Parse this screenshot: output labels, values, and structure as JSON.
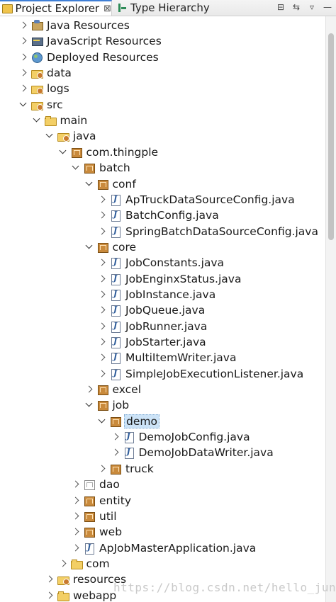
{
  "tabs": [
    {
      "label": "Project Explorer",
      "icon": "project-explorer-icon",
      "close": "⊠"
    },
    {
      "label": "Type Hierarchy",
      "icon": "type-hierarchy-icon"
    }
  ],
  "toolbar": {
    "icons": [
      "collapse-all-icon",
      "link-with-editor-icon",
      "view-menu-icon",
      "minimize-icon"
    ]
  },
  "tree": [
    {
      "label": "Java Resources",
      "depth": 1,
      "twisty": "closed",
      "icon": "java-resources-icon"
    },
    {
      "label": "JavaScript Resources",
      "depth": 1,
      "twisty": "closed",
      "icon": "javascript-resources-icon"
    },
    {
      "label": "Deployed Resources",
      "depth": 1,
      "twisty": "closed",
      "icon": "deployed-resources-icon"
    },
    {
      "label": "data",
      "depth": 1,
      "twisty": "closed",
      "icon": "source-folder-icon"
    },
    {
      "label": "logs",
      "depth": 1,
      "twisty": "closed",
      "icon": "source-folder-icon"
    },
    {
      "label": "src",
      "depth": 1,
      "twisty": "open",
      "icon": "source-folder-icon"
    },
    {
      "label": "main",
      "depth": 2,
      "twisty": "open",
      "icon": "folder-icon"
    },
    {
      "label": "java",
      "depth": 3,
      "twisty": "open",
      "icon": "source-folder-icon"
    },
    {
      "label": "com.thingple",
      "depth": 4,
      "twisty": "open",
      "icon": "package-icon"
    },
    {
      "label": "batch",
      "depth": 5,
      "twisty": "open",
      "icon": "package-icon"
    },
    {
      "label": "conf",
      "depth": 6,
      "twisty": "open",
      "icon": "package-icon"
    },
    {
      "label": "ApTruckDataSourceConfig.java",
      "depth": 7,
      "twisty": "closed",
      "icon": "java-file-icon"
    },
    {
      "label": "BatchConfig.java",
      "depth": 7,
      "twisty": "closed",
      "icon": "java-file-icon"
    },
    {
      "label": "SpringBatchDataSourceConfig.java",
      "depth": 7,
      "twisty": "closed",
      "icon": "java-file-icon"
    },
    {
      "label": "core",
      "depth": 6,
      "twisty": "open",
      "icon": "package-icon"
    },
    {
      "label": "JobConstants.java",
      "depth": 7,
      "twisty": "closed",
      "icon": "java-file-icon"
    },
    {
      "label": "JobEnginxStatus.java",
      "depth": 7,
      "twisty": "closed",
      "icon": "java-file-icon"
    },
    {
      "label": "JobInstance.java",
      "depth": 7,
      "twisty": "closed",
      "icon": "java-file-icon"
    },
    {
      "label": "JobQueue.java",
      "depth": 7,
      "twisty": "closed",
      "icon": "java-file-icon"
    },
    {
      "label": "JobRunner.java",
      "depth": 7,
      "twisty": "closed",
      "icon": "java-file-icon"
    },
    {
      "label": "JobStarter.java",
      "depth": 7,
      "twisty": "closed",
      "icon": "java-file-icon"
    },
    {
      "label": "MultiItemWriter.java",
      "depth": 7,
      "twisty": "closed",
      "icon": "java-file-icon"
    },
    {
      "label": "SimpleJobExecutionListener.java",
      "depth": 7,
      "twisty": "closed",
      "icon": "java-file-icon"
    },
    {
      "label": "excel",
      "depth": 6,
      "twisty": "closed",
      "icon": "package-icon"
    },
    {
      "label": "job",
      "depth": 6,
      "twisty": "open",
      "icon": "package-icon"
    },
    {
      "label": "demo",
      "depth": 7,
      "twisty": "open",
      "icon": "package-icon",
      "selected": true
    },
    {
      "label": "DemoJobConfig.java",
      "depth": 8,
      "twisty": "closed",
      "icon": "java-file-icon"
    },
    {
      "label": "DemoJobDataWriter.java",
      "depth": 8,
      "twisty": "closed",
      "icon": "java-file-icon"
    },
    {
      "label": "truck",
      "depth": 7,
      "twisty": "closed",
      "icon": "package-icon"
    },
    {
      "label": "dao",
      "depth": 5,
      "twisty": "closed",
      "icon": "empty-package-icon"
    },
    {
      "label": "entity",
      "depth": 5,
      "twisty": "closed",
      "icon": "package-icon"
    },
    {
      "label": "util",
      "depth": 5,
      "twisty": "closed",
      "icon": "package-icon"
    },
    {
      "label": "web",
      "depth": 5,
      "twisty": "closed",
      "icon": "package-icon"
    },
    {
      "label": "ApJobMasterApplication.java",
      "depth": 5,
      "twisty": "closed",
      "icon": "java-file-icon"
    },
    {
      "label": "com",
      "depth": 4,
      "twisty": "closed",
      "icon": "folder-icon"
    },
    {
      "label": "resources",
      "depth": 3,
      "twisty": "closed",
      "icon": "source-folder-icon"
    },
    {
      "label": "webapp",
      "depth": 3,
      "twisty": "closed",
      "icon": "folder-icon"
    }
  ],
  "watermark": "https://blog.csdn.net/hello_junz"
}
